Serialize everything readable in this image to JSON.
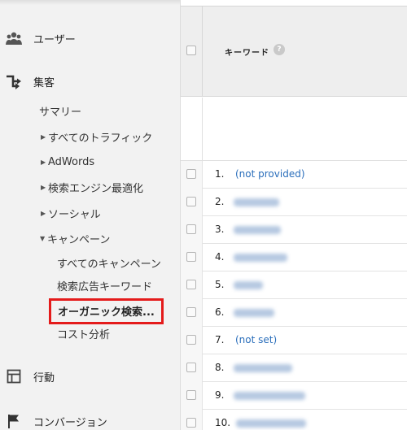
{
  "sidebar": {
    "users": {
      "label": "ユーザー",
      "icon": "users-icon"
    },
    "acquisition": {
      "label": "集客",
      "icon": "acquisition-arrows-icon",
      "summary": "サマリー",
      "all_traffic": "すべてのトラフィック",
      "adwords": "AdWords",
      "seo": "検索エンジン最適化",
      "social": "ソーシャル",
      "campaigns": {
        "label": "キャンペーン",
        "items": [
          "すべてのキャンペーン",
          "検索広告キーワード",
          "オーガニック検索...",
          "コスト分析"
        ]
      }
    },
    "behavior": {
      "label": "行動",
      "icon": "behavior-layout-icon"
    },
    "conversions": {
      "label": "コンバージョン",
      "icon": "flag-icon"
    }
  },
  "table": {
    "header_label": "キーワード",
    "help": "?",
    "rows": [
      {
        "num": "1.",
        "keyword": "(not provided)"
      },
      {
        "num": "2.",
        "keyword": ""
      },
      {
        "num": "3.",
        "keyword": ""
      },
      {
        "num": "4.",
        "keyword": ""
      },
      {
        "num": "5.",
        "keyword": ""
      },
      {
        "num": "6.",
        "keyword": ""
      },
      {
        "num": "7.",
        "keyword": "(not set)"
      },
      {
        "num": "8.",
        "keyword": ""
      },
      {
        "num": "9.",
        "keyword": ""
      },
      {
        "num": "10.",
        "keyword": ""
      }
    ]
  },
  "colors": {
    "highlight": "#e41b1b",
    "link": "#2a6ebb",
    "sidebar_bg": "#f2f2f2"
  }
}
